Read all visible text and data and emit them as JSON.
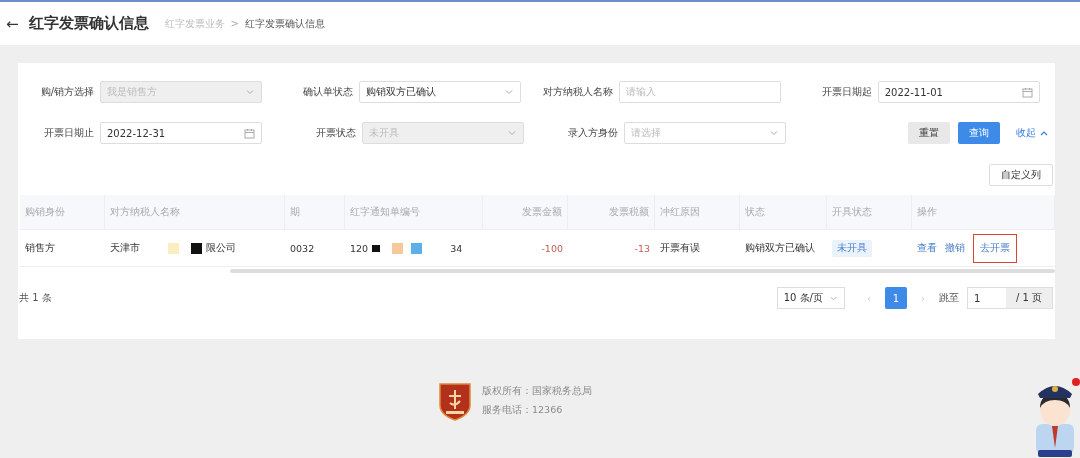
{
  "header": {
    "back": "←",
    "title": "红字发票确认信息",
    "breadcrumb": [
      {
        "label": "红字发票业务",
        "selected": false
      },
      {
        "label": "红字发票确认信息",
        "selected": true
      }
    ],
    "separator": ">"
  },
  "filters": [
    {
      "label": "购/销方选择",
      "kind": "select",
      "value": "我是销售方",
      "disabled": true
    },
    {
      "label": "确认单状态",
      "kind": "select",
      "value": "购销双方已确认",
      "disabled": false
    },
    {
      "label": "对方纳税人名称",
      "kind": "input",
      "placeholder": "请输入",
      "disabled": false
    },
    {
      "label": "开票日期起",
      "kind": "date",
      "value": "2022-11-01",
      "disabled": false
    },
    {
      "label": "开票日期止",
      "kind": "date",
      "value": "2022-12-31",
      "disabled": false
    },
    {
      "label": "开票状态",
      "kind": "select",
      "value": "未开具",
      "disabled": true
    },
    {
      "label": "录入方身份",
      "kind": "select",
      "placeholder": "请选择",
      "disabled": false
    }
  ],
  "buttons": {
    "reset": "重置",
    "query": "查询",
    "collapse": "收起"
  },
  "custom_columns": "自定义列",
  "table": {
    "columns": [
      "购销身份",
      "对方纳税人名称",
      "期",
      "红字通知单编号",
      "发票金额",
      "发票税额",
      "冲红原因",
      "状态",
      "开具状态",
      "操作"
    ],
    "rows": [
      {
        "role": "销售方",
        "name_start": "天津市",
        "name_end": "限公司",
        "column_3": "0032",
        "notice_start": "120",
        "notice_end": "34",
        "amount": "-100",
        "tax": "-13",
        "reason": "开票有误",
        "status": "购销双方已确认",
        "issue_status": "未开具",
        "actions": [
          {
            "label": "查看",
            "highlighted": false
          },
          {
            "label": "撤销",
            "highlighted": false
          },
          {
            "label": "去开票",
            "highlighted": true
          }
        ]
      }
    ]
  },
  "pagination": {
    "total": "共 1 条",
    "page_size": "10 条/页",
    "prev": "‹",
    "pages": [
      {
        "label": "1",
        "selected": true
      }
    ],
    "next": "›",
    "jump_label": "跳至",
    "jump_value": "1",
    "page_count": "/ 1 页"
  },
  "footer": {
    "copyright": "版权所有：国家税务总局",
    "phone": "服务电话：12366"
  }
}
